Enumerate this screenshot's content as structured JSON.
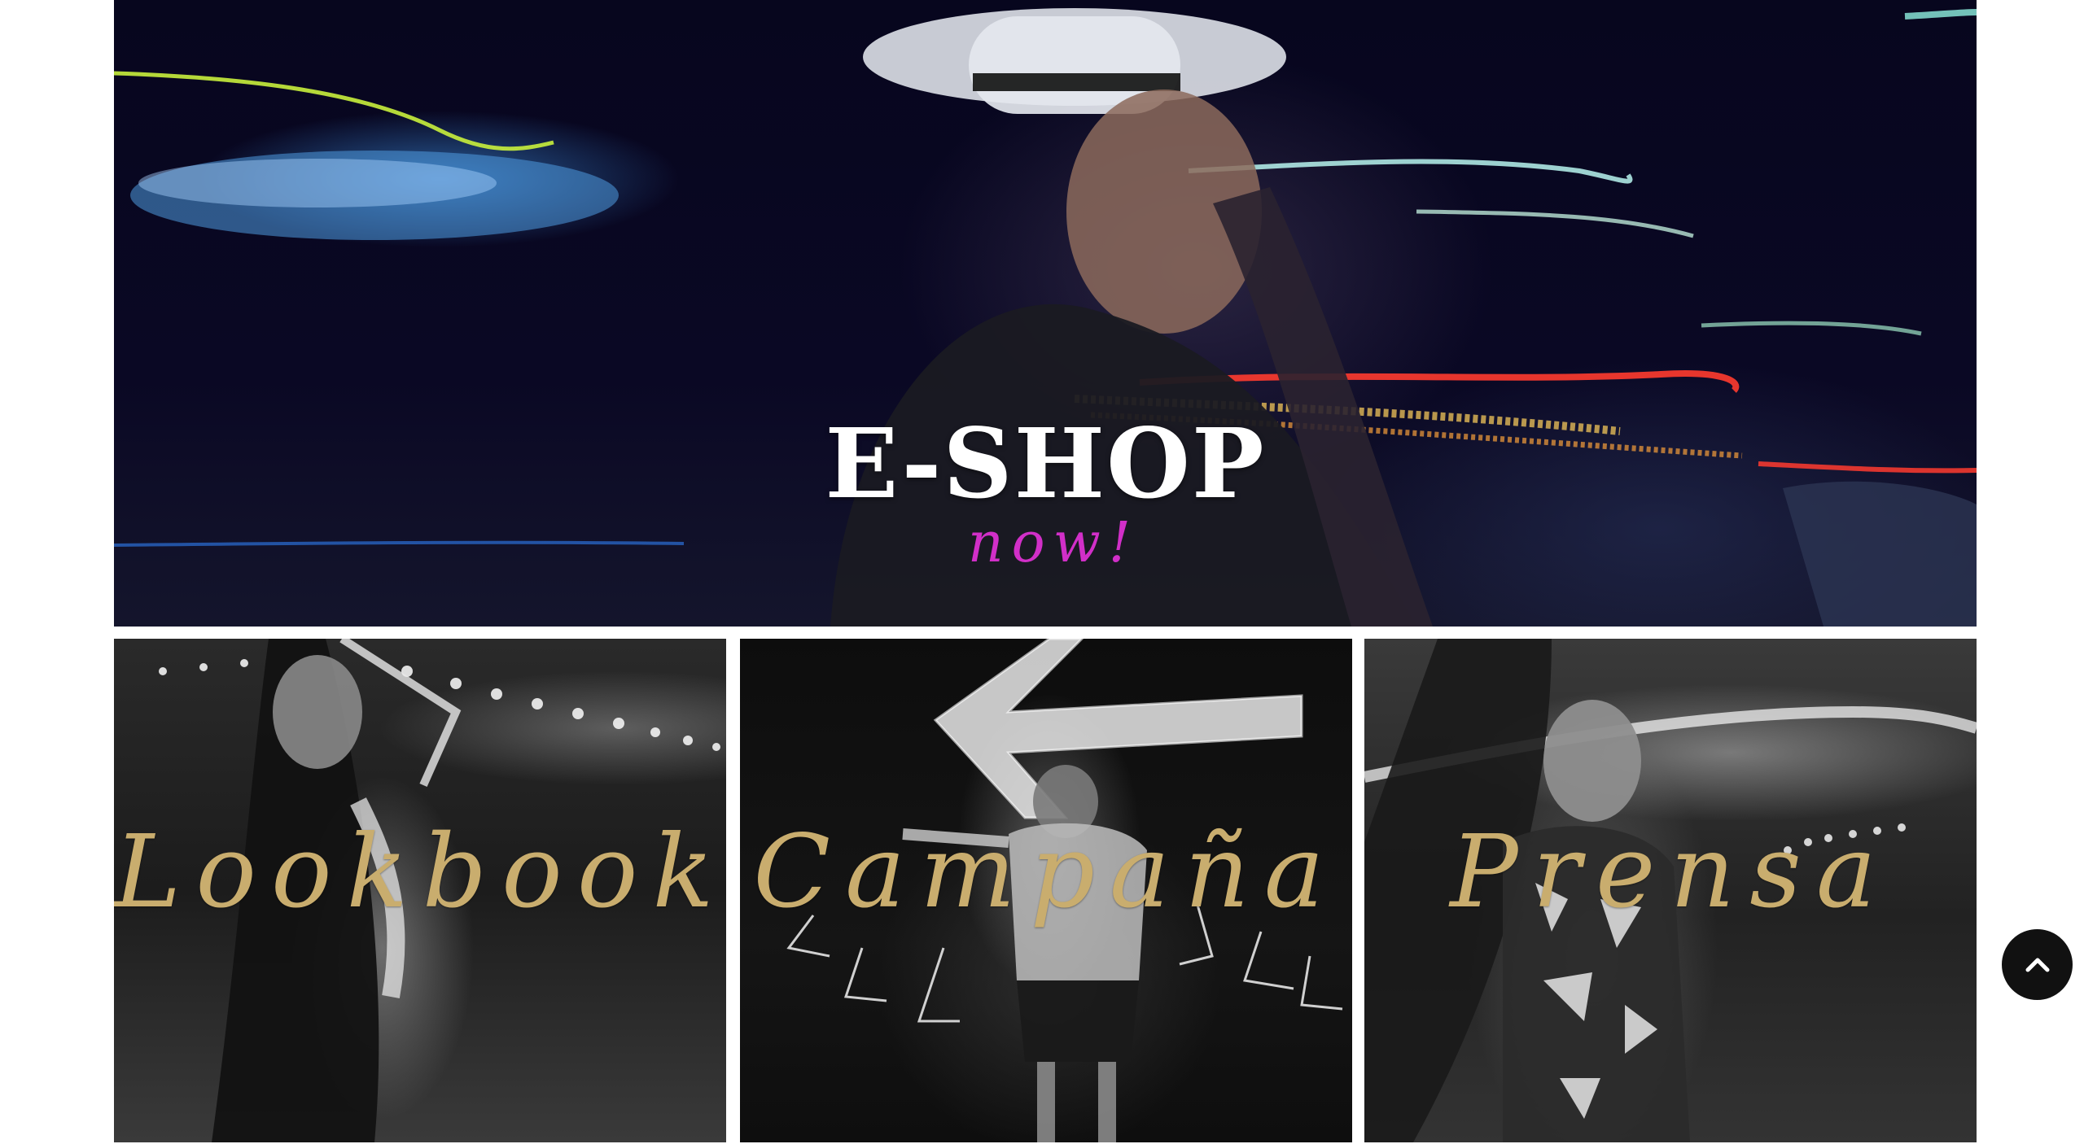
{
  "hero": {
    "title": "E-SHOP",
    "subtitle": "now!",
    "subtitle_color": "#d12fc8",
    "background_color": "#05041a"
  },
  "tiles": [
    {
      "label": "Lookbook"
    },
    {
      "label": "Campaña"
    },
    {
      "label": "Prensa"
    }
  ],
  "label_color": "#c9ad6e",
  "scroll_top": {
    "icon": "chevron-up-icon",
    "background_color": "#111111"
  }
}
